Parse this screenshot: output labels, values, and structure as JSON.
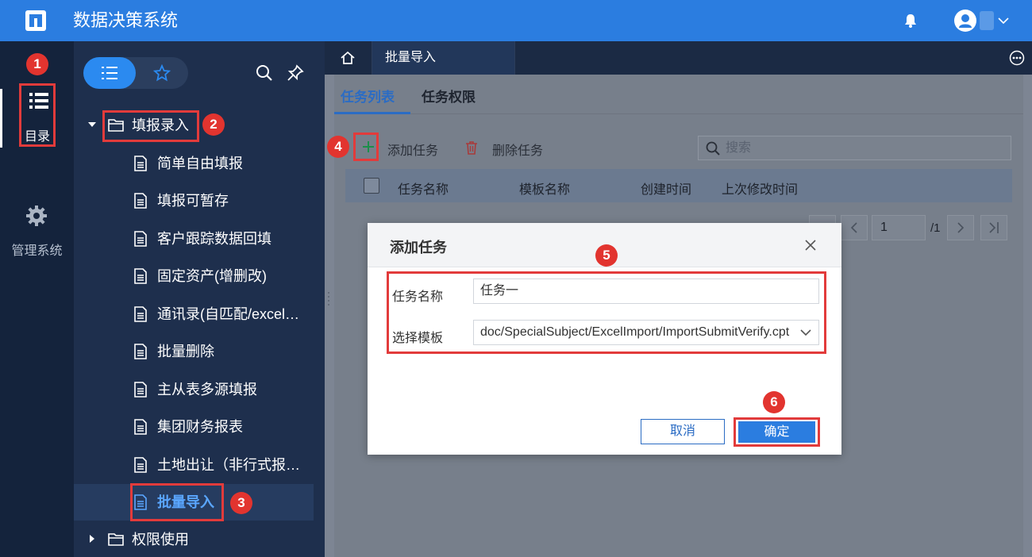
{
  "app": {
    "title": "数据决策系统"
  },
  "rail": {
    "directory_label": "目录",
    "management_label": "管理系统"
  },
  "callouts": [
    "1",
    "2",
    "3",
    "4",
    "5",
    "6"
  ],
  "tree": {
    "folder_open": "填报录入",
    "items": [
      "简单自由填报",
      "填报可暂存",
      "客户跟踪数据回填",
      "固定资产(增删改)",
      "通讯录(自匹配/excel导入)",
      "批量删除",
      "主从表多源填报",
      "集团财务报表",
      "土地出让（非行式报表）"
    ],
    "active_item": "批量导入",
    "folder_closed": "权限使用"
  },
  "tabbar": {
    "active_tab": "批量导入"
  },
  "subtabs": [
    "任务列表",
    "任务权限"
  ],
  "toolbar": {
    "add_label": "添加任务",
    "delete_label": "删除任务",
    "search_placeholder": "搜索"
  },
  "table": {
    "columns": [
      "任务名称",
      "模板名称",
      "创建时间",
      "上次修改时间"
    ]
  },
  "pager": {
    "current_page": "1",
    "total": "/1"
  },
  "dialog": {
    "title": "添加任务",
    "name_label": "任务名称",
    "name_value": "任务一",
    "template_label": "选择模板",
    "template_value": "doc/SpecialSubject/ExcelImport/ImportSubmitVerify.cpt",
    "cancel_label": "取消",
    "ok_label": "确定"
  },
  "colors": {
    "accent": "#2b7de0",
    "highlight": "#e23b3b",
    "sidebar": "#1e2f4d"
  }
}
